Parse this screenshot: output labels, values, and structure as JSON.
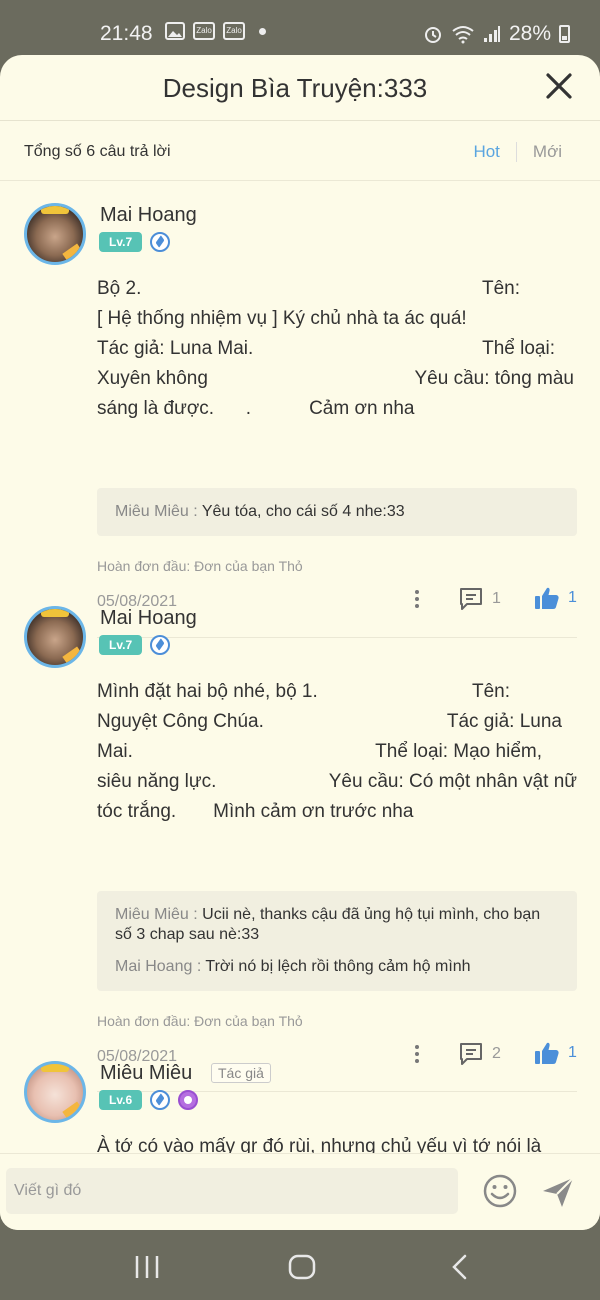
{
  "status_bar": {
    "time": "21:48",
    "notif_icons": [
      "image-icon",
      "zalo-icon",
      "zalo-icon"
    ],
    "zalo_label": "Zalo",
    "battery": "28%"
  },
  "header": {
    "title": "Design Bìa Truyện:333"
  },
  "subbar": {
    "count": "Tổng số 6 câu trả lời",
    "tab_hot": "Hot",
    "tab_new": "Mới"
  },
  "comments": [
    {
      "name": "Mai Hoang",
      "level": "Lv.7",
      "lines": [
        [
          "Bộ 2.",
          "Tên:"
        ],
        [
          "[ Hệ thống nhiệm vụ ] Ký chủ nhà ta ác quá!",
          ""
        ],
        [
          "Tác giả: Luna Mai.",
          "Thể loại:"
        ],
        [
          "Xuyên không",
          "Yêu cầu: tông màu"
        ],
        [
          "sáng là được.      .           Cảm ơn nha",
          ""
        ]
      ],
      "replies": [
        {
          "name": "Miêu Miêu :",
          "text": "Yêu tóa, cho cái số 4 nhe:33"
        }
      ],
      "note": "Hoàn đơn đầu: Đơn của bạn Thỏ",
      "date": "05/08/2021",
      "reply_count": "1",
      "like_count": "1"
    },
    {
      "name": "Mai Hoang",
      "level": "Lv.7",
      "lines": [
        [
          "Mình đặt hai bộ nhé, bộ 1.",
          "Tên:"
        ],
        [
          "Nguyệt Công Chúa.",
          "Tác giả: Luna"
        ],
        [
          "Mai.",
          "Thể loại: Mạo hiểm,"
        ],
        [
          "siêu năng lực.",
          "Yêu cầu: Có một nhân vật nữ"
        ],
        [
          "tóc trắng.       Mình cảm ơn trước nha",
          ""
        ]
      ],
      "replies": [
        {
          "name": "Miêu Miêu :",
          "text": "Ucii nè, thanks cậu đã ủng hộ tụi mình, cho bạn số 3 chap sau nè:33"
        },
        {
          "name": "Mai Hoang :",
          "text": "Trời nó bị lệch rồi thông cảm hộ mình"
        }
      ],
      "note": "Hoàn đơn đầu: Đơn của bạn Thỏ",
      "date": "05/08/2021",
      "reply_count": "2",
      "like_count": "1"
    },
    {
      "name": "Miêu Miêu",
      "author_tag": "Tác giả",
      "level": "Lv.6",
      "lines": [
        [
          "À tớ có vào mấy gr đó rùi, nhưng chủ yếu vì tớ nói là",
          ""
        ]
      ]
    }
  ],
  "input": {
    "placeholder": "Viết gì đó"
  },
  "colors": {
    "accent_blue": "#5aa5e0",
    "level_badge": "#57c3b5",
    "sheet_bg": "#fdfbe8"
  }
}
